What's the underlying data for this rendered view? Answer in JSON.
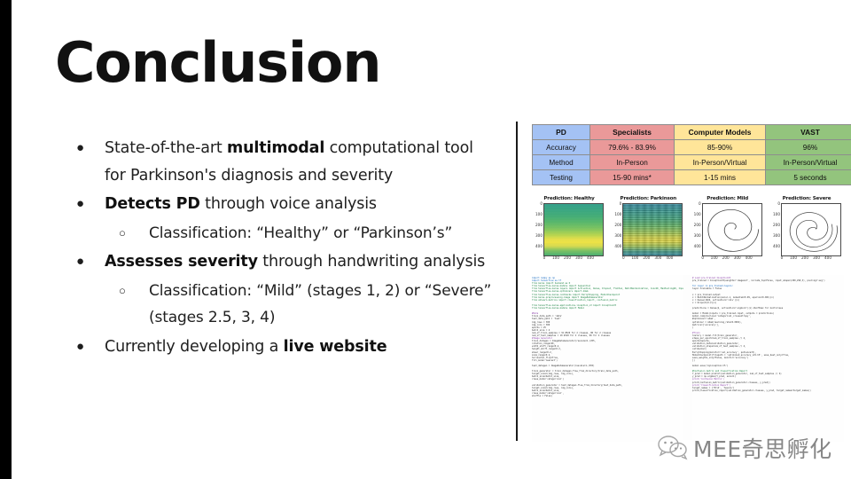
{
  "slide": {
    "title": "Conclusion",
    "accent_black": "#000000"
  },
  "bullets": [
    {
      "level": 1,
      "marker": "●",
      "html": "State-of-the-art <b>multimodal</b> computational tool  for Parkinson's diagnosis and severity"
    },
    {
      "level": 1,
      "marker": "●",
      "html": "<b>Detects PD</b> through voice analysis"
    },
    {
      "level": 2,
      "marker": "○",
      "html": "Classification: “Healthy” or “Parkinson’s”"
    },
    {
      "level": 1,
      "marker": "●",
      "html": "<b>Assesses severity</b> through handwriting analysis"
    },
    {
      "level": 2,
      "marker": "○",
      "html": "Classification: “Mild” (stages 1, 2) or “Severe” (stages 2.5, 3, 4)"
    },
    {
      "level": 1,
      "marker": "●",
      "html": "Currently developing a <b>live website</b>"
    }
  ],
  "comparison_table": {
    "colors": {
      "col_pd": "#a4c2f4",
      "col_specialists": "#ea9999",
      "col_computer_models": "#ffe599",
      "col_vast": "#93c47d"
    },
    "headers": [
      "PD",
      "Specialists",
      "Computer Models",
      "VAST"
    ],
    "rows": [
      [
        "Accuracy",
        "79.6% - 83.9%",
        "85-90%",
        "96%"
      ],
      [
        "Method",
        "In-Person",
        "In-Person/Virtual",
        "In-Person/Virtual"
      ],
      [
        "Testing",
        "15-90 mins*",
        "1-15 mins",
        "5 seconds"
      ]
    ]
  },
  "chart_data": [
    {
      "type": "heatmap",
      "title": "Prediction: Healthy",
      "xlabel": "",
      "ylabel": "",
      "xticks": [
        0,
        100,
        200,
        300,
        400
      ],
      "yticks": [
        0,
        100,
        200,
        300,
        400
      ],
      "xlim": [
        0,
        470
      ],
      "ylim": [
        470,
        0
      ],
      "colormap": "viridis",
      "description": "Mel spectrogram of a healthy voice sample; smooth horizontal energy bands, bright yellow band near y=400-450"
    },
    {
      "type": "heatmap",
      "title": "Prediction: Parkinson",
      "xlabel": "",
      "ylabel": "",
      "xticks": [
        0,
        100,
        200,
        300,
        400
      ],
      "yticks": [
        0,
        100,
        200,
        300,
        400
      ],
      "xlim": [
        0,
        470
      ],
      "ylim": [
        470,
        0
      ],
      "colormap": "viridis",
      "description": "Mel spectrogram of a Parkinson's voice sample; striated harmonics and vertical discontinuities"
    },
    {
      "type": "line",
      "title": "Prediction: Mild",
      "xlabel": "",
      "ylabel": "",
      "xticks": [
        0,
        100,
        200,
        300,
        400
      ],
      "yticks": [
        0,
        100,
        200,
        300,
        400
      ],
      "xlim": [
        0,
        470
      ],
      "ylim": [
        470,
        0
      ],
      "series": [
        {
          "name": "spiral",
          "description": "Smooth Archimedean hand-drawn spiral, ~3 turns, low tremor"
        }
      ]
    },
    {
      "type": "line",
      "title": "Prediction: Severe",
      "xlabel": "",
      "ylabel": "",
      "xticks": [
        0,
        100,
        200,
        300,
        400
      ],
      "yticks": [
        0,
        100,
        200,
        300,
        400
      ],
      "xlim": [
        0,
        470
      ],
      "ylim": [
        470,
        0
      ],
      "series": [
        {
          "name": "spiral",
          "description": "Irregular hand-drawn spiral, ~3 turns, distorted loops indicating tremor"
        }
      ]
    }
  ],
  "code_left": [
    {
      "t": "k",
      "x": "import numpy as np"
    },
    {
      "t": "k",
      "x": "import tensorflow as tf"
    },
    {
      "t": "cm",
      "x": "from keras import backend as K"
    },
    {
      "t": "cm",
      "x": "from tensorflow.keras.models import Sequential"
    },
    {
      "t": "cm",
      "x": "from tensorflow.keras.layers import Activation, Dense, Dropout, Flatten, BatchNormalization, Conv2D, MaxPooling2D, Input"
    },
    {
      "t": "cm",
      "x": "from tensorflow.keras.optimizers import Adam"
    },
    {
      "t": "cm",
      "x": "from tensorflow.keras.callbacks import EarlyStopping, ModelCheckpoint"
    },
    {
      "t": "cm",
      "x": "from keras.preprocessing.image import ImageDataGenerator"
    },
    {
      "t": "cm",
      "x": "from sklearn.metrics import classification_report, confusion_matrix"
    },
    {
      "t": "gap",
      "x": ""
    },
    {
      "t": "cm",
      "x": "from tensorflow.keras.applications.inception_v3 import InceptionV3"
    },
    {
      "t": "cm",
      "x": "from tensorflow.keras.models import Model"
    },
    {
      "t": "gap",
      "x": ""
    },
    {
      "t": "n",
      "x": "#Data"
    },
    {
      "t": "d",
      "x": "train_data_path = 'data'"
    },
    {
      "t": "d",
      "x": "test_data_path = 'test'"
    },
    {
      "t": "d",
      "x": "img_rows = 300"
    },
    {
      "t": "d",
      "x": "img_cols = 300"
    },
    {
      "t": "d",
      "x": "epochs = 25"
    },
    {
      "t": "d",
      "x": "batch_size = 4"
    },
    {
      "t": "d",
      "x": "num_of_train_samples = 32 #520 for 2 classes, 80 for 2 classes"
    },
    {
      "t": "d",
      "x": "num_of_test_samples = 10 #118 for 2 classes, 66 for 2 classes"
    },
    {
      "t": "n",
      "x": "#Image Generator"
    },
    {
      "t": "d",
      "x": "train_datagen = ImageDataGenerator(rescale=1./255,"
    },
    {
      "t": "d",
      "x": "                                  rotation_range=40,"
    },
    {
      "t": "d",
      "x": "                                  width_shift_range=0.2,"
    },
    {
      "t": "d",
      "x": "                                  height_shift_range=0.2,"
    },
    {
      "t": "d",
      "x": "                                  shear_range=0.2,"
    },
    {
      "t": "d",
      "x": "                                  zoom_range=0.2,"
    },
    {
      "t": "d",
      "x": "                                  horizontal_flip=True,"
    },
    {
      "t": "d",
      "x": "                                  fill_mode='nearest')"
    },
    {
      "t": "gap",
      "x": ""
    },
    {
      "t": "d",
      "x": "test_datagen = ImageDataGenerator(rescale=1./255)"
    },
    {
      "t": "gap",
      "x": ""
    },
    {
      "t": "d",
      "x": "train_generator = train_datagen.flow_from_directory(train_data_path,"
    },
    {
      "t": "d",
      "x": "                                    target_size=(img_rows, img_cols),"
    },
    {
      "t": "d",
      "x": "                                    batch_size=batch_size,"
    },
    {
      "t": "d",
      "x": "                                    class_mode='categorical')"
    },
    {
      "t": "gap",
      "x": ""
    },
    {
      "t": "d",
      "x": "validation_generator = test_datagen.flow_from_directory(test_data_path,"
    },
    {
      "t": "d",
      "x": "                                    target_size=(img_rows, img_cols),"
    },
    {
      "t": "d",
      "x": "                                    batch_size=batch_size,"
    },
    {
      "t": "d",
      "x": "                                    class_mode='categorical',"
    },
    {
      "t": "d",
      "x": "                                    shuffle = False)"
    }
  ],
  "code_right": [
    {
      "t": "n",
      "x": "# Load pre-trained InceptionV3"
    },
    {
      "t": "d",
      "x": "pre_trained = InceptionV3(weights='imagenet', include_top=False, input_shape=(299,299,3), pooling='avg')"
    },
    {
      "t": "gap",
      "x": ""
    },
    {
      "t": "k",
      "x": "for layer in pre_trained.layers:"
    },
    {
      "t": "d",
      "x": "    layer.trainable = False"
    },
    {
      "t": "gap",
      "x": ""
    },
    {
      "t": "d",
      "x": "x = pre_trained.output"
    },
    {
      "t": "d",
      "x": "x = BatchNormalization(axis=-1, momentum=0.99, epsilon=0.001)(x)"
    },
    {
      "t": "d",
      "x": "x = Dense(1024, activation='relu')(x)"
    },
    {
      "t": "d",
      "x": "x = Dropout(0.2)(x)"
    },
    {
      "t": "gap",
      "x": ""
    },
    {
      "t": "d",
      "x": "predictions = Dense(2, activation='sigmoid')(x) #softmax for multiclass"
    },
    {
      "t": "gap",
      "x": ""
    },
    {
      "t": "d",
      "x": "model = Model(inputs = pre_trained.input, outputs = predictions)"
    },
    {
      "t": "d",
      "x": "model.compile(loss='categorical_crossentropy',"
    },
    {
      "t": "d",
      "x": "              #optimizer='adam',"
    },
    {
      "t": "d",
      "x": "              optimizer = Adam(learning_rate=0.0001),"
    },
    {
      "t": "d",
      "x": "              metrics=['accuracy'],"
    },
    {
      "t": "d",
      "x": "             )"
    },
    {
      "t": "gap",
      "x": ""
    },
    {
      "t": "n",
      "x": "#Train"
    },
    {
      "t": "d",
      "x": "history = model.fit(train_generator,"
    },
    {
      "t": "d",
      "x": "            steps_per_epoch=num_of_train_samples // 4,"
    },
    {
      "t": "d",
      "x": "            epochs=epochs,"
    },
    {
      "t": "d",
      "x": "            validation_data=validation_generator,"
    },
    {
      "t": "d",
      "x": "            validation_steps=num_of_test_samples // 4,"
    },
    {
      "t": "d",
      "x": "            callbacks=["
    },
    {
      "t": "d",
      "x": "                EarlyStopping(monitor='val_accuracy', patience=5),"
    },
    {
      "t": "d",
      "x": "                ModelCheckpoint(filepath = 'optimized_accuracy_v15.h5', save_best_only=True,"
    },
    {
      "t": "d",
      "x": "                save_weights_only=False, monitor='accuracy')"
    },
    {
      "t": "d",
      "x": "            ])"
    },
    {
      "t": "gap",
      "x": ""
    },
    {
      "t": "d",
      "x": "model.save('myinception.h5')"
    },
    {
      "t": "gap",
      "x": ""
    },
    {
      "t": "cm",
      "x": "#Confusion matrix and Classification Report"
    },
    {
      "t": "d",
      "x": "Y_pred = model.predict(validation_generator, num_of_test_samples // 4)"
    },
    {
      "t": "d",
      "x": "y_pred = np.argmax(Y_pred, axis=1)"
    },
    {
      "t": "n",
      "x": "print('Confusion Matrix')"
    },
    {
      "t": "d",
      "x": "print(confusion_matrix(validation_generator.classes, y_pred))"
    },
    {
      "t": "n",
      "x": "print('Classification Report')"
    },
    {
      "t": "d",
      "x": "target_names = ['Mild', 'Severe']"
    },
    {
      "t": "d",
      "x": "print(classification_report(validation_generator.classes, y_pred, target_names=target_names))"
    }
  ],
  "watermark": {
    "text": "MEE奇思孵化",
    "icon": "wechat-icon"
  }
}
